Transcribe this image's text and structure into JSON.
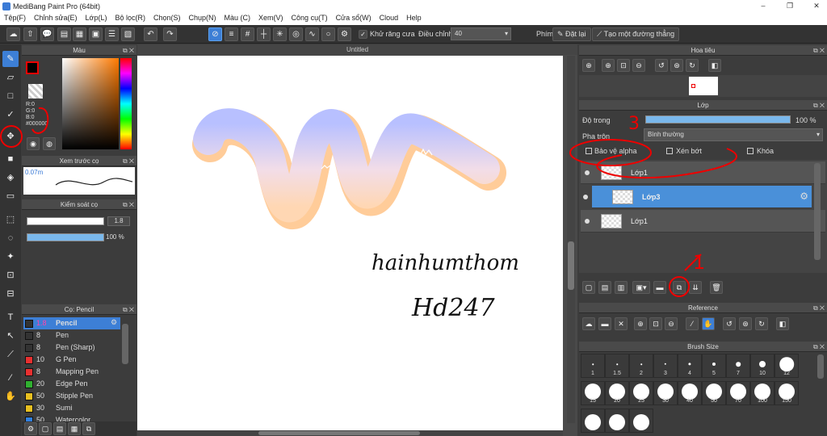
{
  "app": {
    "title": "MediBang Paint Pro (64bit)"
  },
  "menu": [
    "Tệp(F)",
    "Chỉnh sửa(E)",
    "Lớp(L)",
    "Bộ lọc(R)",
    "Chọn(S)",
    "Chụp(N)",
    "Màu (C)",
    "Xem(V)",
    "Công cụ(T)",
    "Cửa sổ(W)",
    "Cloud",
    "Help"
  ],
  "toolbar": {
    "antialias_label": "Khử răng cưa",
    "adjust_label": "Điều chỉnh",
    "adjust_value": "40",
    "shortcut_label": "Phím",
    "reset_label": "Đặt lại",
    "ruler_label": "Tạo một đường thẳng"
  },
  "color_panel": {
    "title": "Màu",
    "r": "R:0",
    "g": "G:0",
    "b": "B:0",
    "hex": "#000000",
    "fg": "#000000",
    "bg": "#ffffff"
  },
  "preview_panel": {
    "title": "Xem trước cọ",
    "size": "0.07m"
  },
  "brush_control": {
    "title": "Kiểm soát cọ",
    "size": "1.8",
    "opacity": "100 %"
  },
  "brush_panel": {
    "title": "Cọ: Pencil",
    "items": [
      {
        "size": "1.8",
        "name": "Pencil",
        "color": "#333333",
        "selected": true
      },
      {
        "size": "8",
        "name": "Pen",
        "color": "#333333"
      },
      {
        "size": "8",
        "name": "Pen (Sharp)",
        "color": "#333333"
      },
      {
        "size": "10",
        "name": "G Pen",
        "color": "#e83030"
      },
      {
        "size": "8",
        "name": "Mapping Pen",
        "color": "#e83030"
      },
      {
        "size": "20",
        "name": "Edge Pen",
        "color": "#30b030"
      },
      {
        "size": "50",
        "name": "Stipple Pen",
        "color": "#e8c020"
      },
      {
        "size": "30",
        "name": "Sumi",
        "color": "#e8c020"
      },
      {
        "size": "50",
        "name": "Watercolor",
        "color": "#3080e0"
      }
    ]
  },
  "canvas": {
    "title": "Untitled",
    "text1": "hainhumthom",
    "text2": "Hd247"
  },
  "navigator": {
    "title": "Hoa tiêu"
  },
  "layer_panel": {
    "title": "Lớp",
    "opacity_label": "Độ trong",
    "opacity_value": "100 %",
    "blend_label": "Pha trộn",
    "blend_value": "Bình thường",
    "protect_alpha": "Bảo vệ alpha",
    "clipping": "Xén bớt",
    "lock": "Khóa",
    "layers": [
      {
        "name": "Lớp1",
        "selected": false
      },
      {
        "name": "Lớp3",
        "selected": true
      },
      {
        "name": "Lớp1",
        "selected": false
      }
    ]
  },
  "reference_panel": {
    "title": "Reference"
  },
  "brushsize_panel": {
    "title": "Brush Size",
    "sizes": [
      "1",
      "1.5",
      "2",
      "3",
      "4",
      "5",
      "7",
      "10",
      "12",
      "15",
      "20",
      "25",
      "30",
      "40",
      "50",
      "70",
      "100",
      "150"
    ]
  },
  "annotations": {
    "n1": "1",
    "n3": "3"
  }
}
